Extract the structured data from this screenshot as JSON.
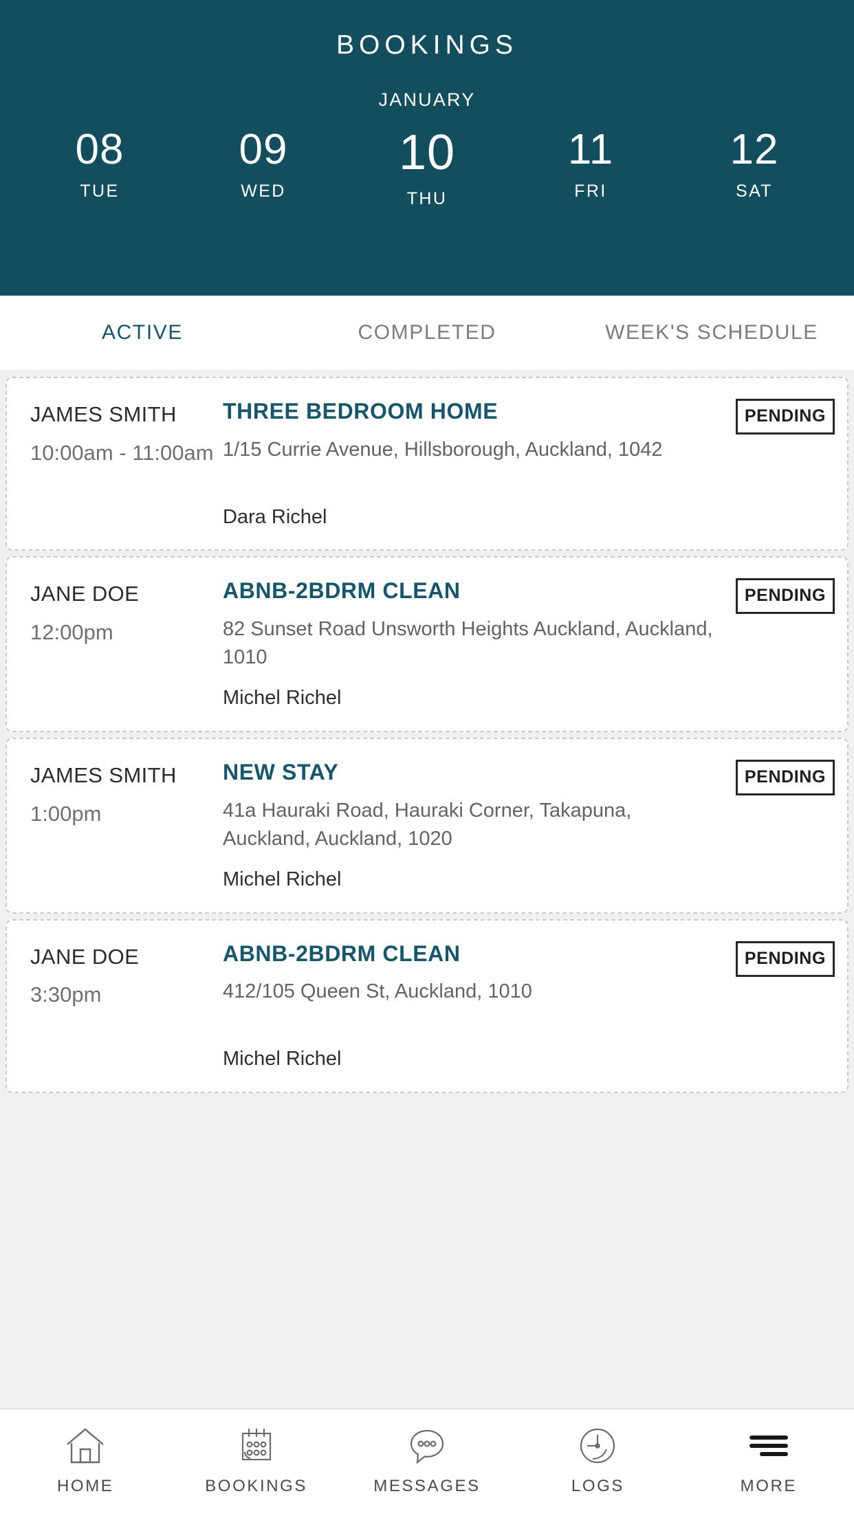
{
  "header": {
    "title": "BOOKINGS",
    "month": "JANUARY",
    "dates": [
      {
        "day": "08",
        "dow": "TUE",
        "selected": false
      },
      {
        "day": "09",
        "dow": "WED",
        "selected": false
      },
      {
        "day": "10",
        "dow": "THU",
        "selected": true
      },
      {
        "day": "11",
        "dow": "FRI",
        "selected": false
      },
      {
        "day": "12",
        "dow": "SAT",
        "selected": false
      }
    ],
    "background_color": "#134e5e"
  },
  "tabs": [
    {
      "label": "ACTIVE",
      "active": true
    },
    {
      "label": "COMPLETED",
      "active": false
    },
    {
      "label": "WEEK'S SCHEDULE",
      "active": false
    }
  ],
  "accent_color": "#16566a",
  "bookings": [
    {
      "client": "JAMES SMITH",
      "time": "10:00am - 11:00am",
      "job_title": "THREE BEDROOM HOME",
      "address": "1/15 Currie Avenue, Hillsborough, Auckland, 1042",
      "cleaner": "Dara  Richel",
      "status": "PENDING"
    },
    {
      "client": "JANE DOE",
      "time": "12:00pm",
      "job_title": "ABNB-2BDRM CLEAN",
      "address": "82 Sunset Road Unsworth Heights Auckland, Auckland, 1010",
      "cleaner": "Michel  Richel",
      "status": "PENDING"
    },
    {
      "client": "JAMES SMITH",
      "time": "1:00pm",
      "job_title": "NEW STAY",
      "address": "41a Hauraki Road, Hauraki Corner, Takapuna, Auckland, Auckland, 1020",
      "cleaner": "Michel  Richel",
      "status": "PENDING"
    },
    {
      "client": "JANE DOE",
      "time": "3:30pm",
      "job_title": "ABNB-2BDRM CLEAN",
      "address": "412/105 Queen St, Auckland, 1010",
      "cleaner": "Michel  Richel",
      "status": "PENDING"
    }
  ],
  "bottom_nav": [
    {
      "label": "HOME",
      "icon": "home-icon"
    },
    {
      "label": "BOOKINGS",
      "icon": "calendar-icon"
    },
    {
      "label": "MESSAGES",
      "icon": "chat-bubble-icon"
    },
    {
      "label": "LOGS",
      "icon": "clock-icon"
    },
    {
      "label": "MORE",
      "icon": "hamburger-menu-icon"
    }
  ]
}
